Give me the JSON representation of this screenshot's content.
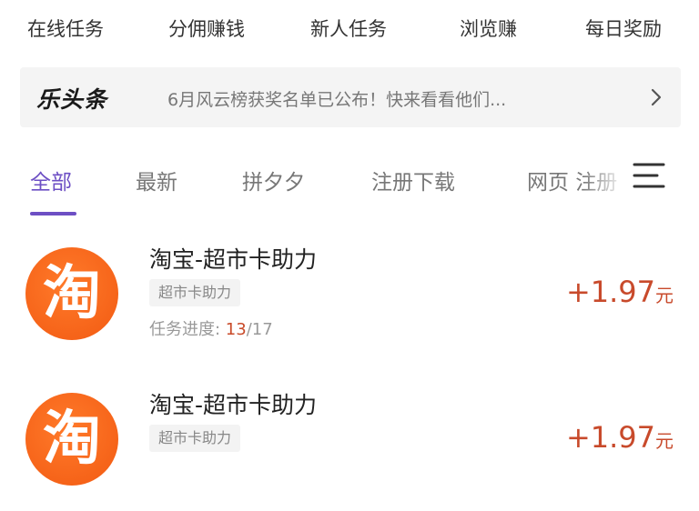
{
  "topnav": {
    "items": [
      {
        "label": "在线任务"
      },
      {
        "label": "分佣赚钱"
      },
      {
        "label": "新人任务"
      },
      {
        "label": "浏览赚"
      },
      {
        "label": "每日奖励"
      }
    ]
  },
  "banner": {
    "brand": "乐头条",
    "message": "6月风云榜获奖名单已公布！快来看看他们..."
  },
  "tabs": {
    "items": [
      {
        "label": "全部"
      },
      {
        "label": "最新"
      },
      {
        "label": "拼夕夕"
      },
      {
        "label": "注册下载"
      },
      {
        "label": "网页 注册"
      }
    ],
    "active_color": "#6d4fc4"
  },
  "tasks": [
    {
      "logo_char": "淘",
      "title": "淘宝-超市卡助力",
      "tag": "超市卡助力",
      "progress_label": "任务进度: ",
      "progress_current": "13",
      "progress_total": "/17",
      "reward": "+1.97",
      "reward_unit": "元"
    },
    {
      "logo_char": "淘",
      "title": "淘宝-超市卡助力",
      "tag": "超市卡助力",
      "reward": "+1.97",
      "reward_unit": "元"
    }
  ],
  "colors": {
    "accent": "#6d4fc4",
    "reward": "#c84a2b",
    "logo": "#f25a12"
  }
}
